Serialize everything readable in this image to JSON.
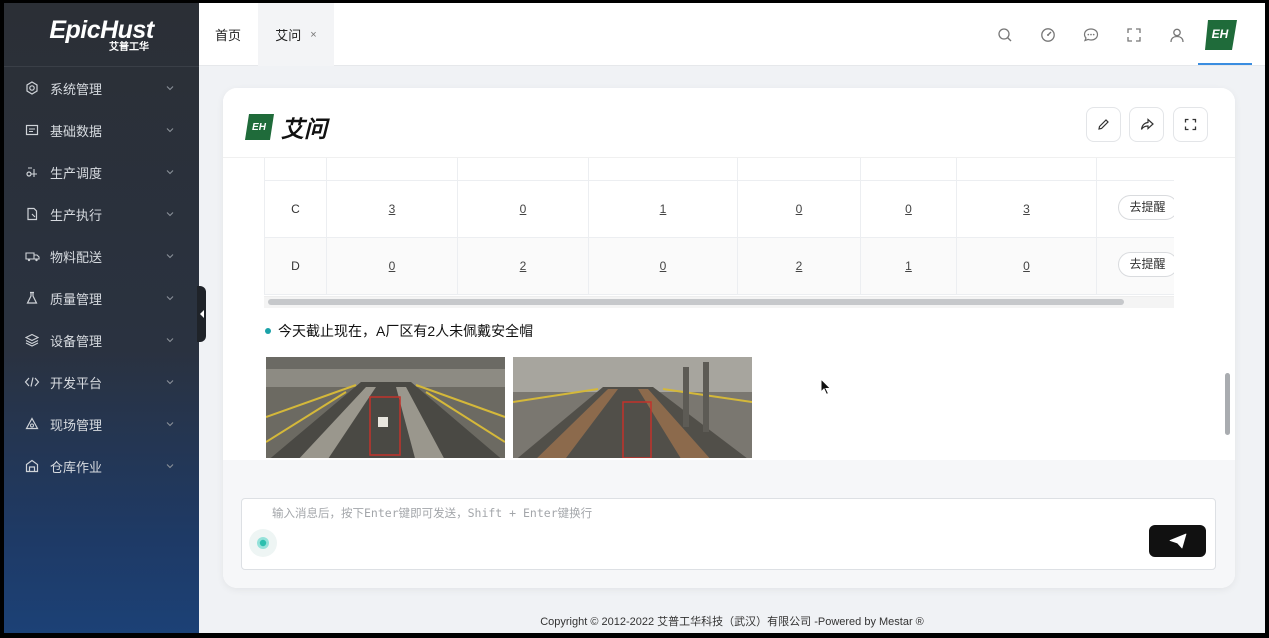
{
  "brand": {
    "name": "EpicHust",
    "sub": "艾普工华",
    "mark": "EH"
  },
  "sidebar": {
    "items": [
      {
        "label": "系统管理",
        "icon": "gear-icon"
      },
      {
        "label": "基础数据",
        "icon": "table-icon"
      },
      {
        "label": "生产调度",
        "icon": "schedule-icon"
      },
      {
        "label": "生产执行",
        "icon": "document-icon"
      },
      {
        "label": "物料配送",
        "icon": "truck-icon"
      },
      {
        "label": "质量管理",
        "icon": "flask-icon"
      },
      {
        "label": "设备管理",
        "icon": "layers-icon"
      },
      {
        "label": "开发平台",
        "icon": "code-icon"
      },
      {
        "label": "现场管理",
        "icon": "site-icon"
      },
      {
        "label": "仓库作业",
        "icon": "warehouse-icon"
      }
    ]
  },
  "tabs": {
    "home": "首页",
    "active": "艾问",
    "close": "×"
  },
  "chat": {
    "title": "艾问",
    "table": {
      "rows": [
        {
          "label": "C",
          "values": [
            "3",
            "0",
            "1",
            "0",
            "0",
            "3"
          ],
          "action": "去提醒"
        },
        {
          "label": "D",
          "values": [
            "0",
            "2",
            "0",
            "2",
            "1",
            "0"
          ],
          "action": "去提醒"
        }
      ]
    },
    "message": "今天截止现在，A厂区有2人未佩戴安全帽"
  },
  "composer": {
    "placeholder": "输入消息后，按下Enter键即可发送，Shift + Enter键换行"
  },
  "footer": "Copyright © 2012-2022 艾普工华科技（武汉）有限公司 -Powered by Mestar ®",
  "colors": {
    "accent": "#1aa2a8",
    "brand_green": "#1f6b3a",
    "sidebar": "#2b2f36"
  }
}
